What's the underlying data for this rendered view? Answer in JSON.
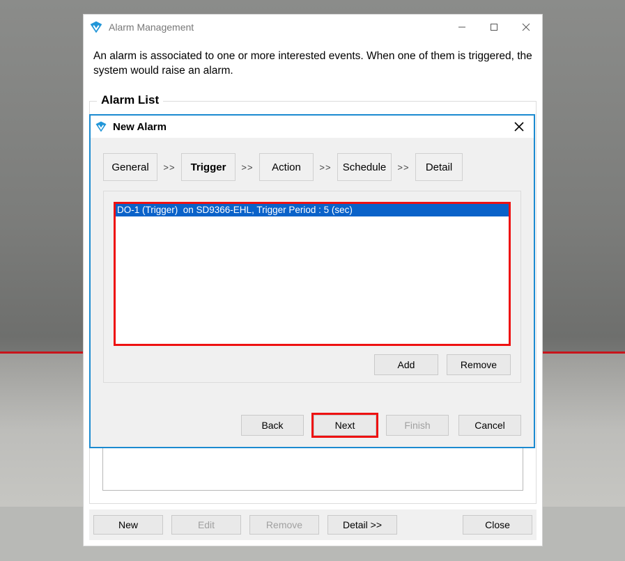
{
  "parent": {
    "title": "Alarm Management",
    "description": "An alarm is associated to one or more interested events. When one of them is triggered, the system would raise an alarm.",
    "list_legend": "Alarm List",
    "buttons": {
      "new": "New",
      "edit": "Edit",
      "remove": "Remove",
      "detail": "Detail >>",
      "close": "Close"
    }
  },
  "modal": {
    "title": "New Alarm",
    "steps": {
      "general": "General",
      "trigger": "Trigger",
      "action": "Action",
      "schedule": "Schedule",
      "detail": "Detail",
      "sep": ">>"
    },
    "items": [
      "DO-1 (Trigger)  on SD9366-EHL, Trigger Period : 5 (sec)"
    ],
    "list_buttons": {
      "add": "Add",
      "remove": "Remove"
    },
    "wiz_buttons": {
      "back": "Back",
      "next": "Next",
      "finish": "Finish",
      "cancel": "Cancel"
    }
  }
}
